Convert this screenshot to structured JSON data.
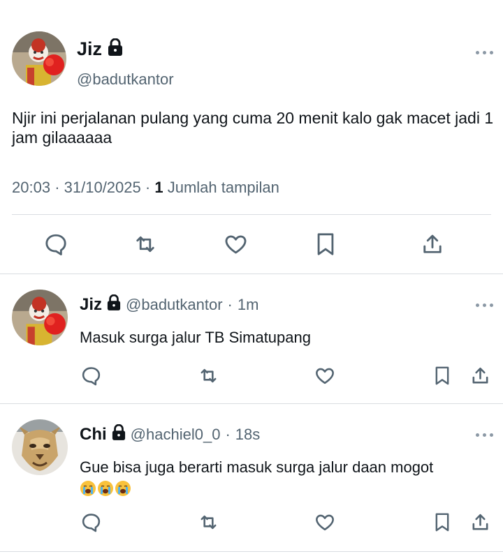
{
  "main_tweet": {
    "name": "Jiz",
    "handle": "@badutkantor",
    "text": "Njir ini perjalanan pulang yang cuma 20 menit kalo gak macet jadi 1 jam gilaaaaaa",
    "time": "20:03",
    "sep1": "·",
    "date": "31/10/2025",
    "sep2": "·",
    "views_count": "1",
    "views_label": "Jumlah tampilan"
  },
  "replies": [
    {
      "name": "Jiz",
      "handle": "@badutkantor",
      "sep": "·",
      "age": "1m",
      "text": "Masuk surga jalur TB Simatupang"
    },
    {
      "name": "Chi",
      "handle": "@hachiel0_0",
      "sep": "·",
      "age": "18s",
      "text": "Gue bisa juga berarti masuk surga jalur daan mogot",
      "emojis": [
        "loudly-crying-face",
        "loudly-crying-face",
        "loudly-crying-face"
      ]
    }
  ],
  "icons": {
    "reply": "reply-icon",
    "retweet": "retweet-icon",
    "like": "heart-icon",
    "bookmark": "bookmark-icon",
    "share": "share-icon",
    "lock": "lock-icon",
    "more": "more-icon"
  },
  "colors": {
    "text": "#0f1419",
    "secondary": "#536471",
    "icon": "#536471",
    "divider": "#d9dde1"
  }
}
